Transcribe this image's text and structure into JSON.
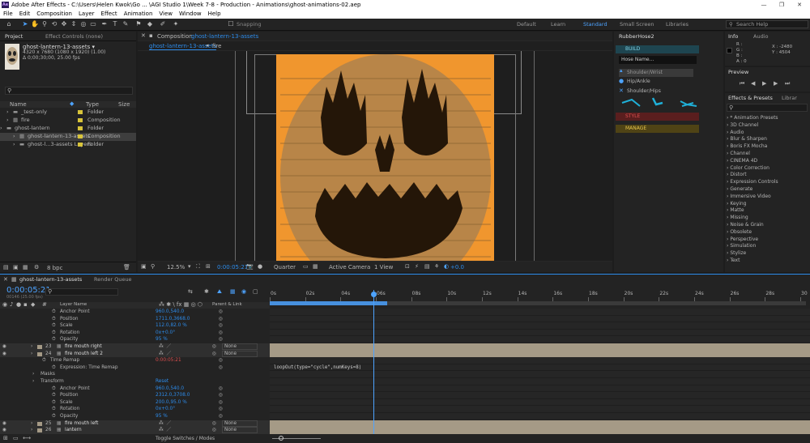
{
  "title": "Adobe After Effects - C:\\Users\\Helen Kwok\\Go ... \\AGI Studio 1\\Week 7-8 - Production - Animations\\ghost-animations-02.aep",
  "logo": "Ae",
  "menu": [
    "File",
    "Edit",
    "Composition",
    "Layer",
    "Effect",
    "Animation",
    "View",
    "Window",
    "Help"
  ],
  "toolbar": {
    "snapping": "Snapping"
  },
  "workspaces": [
    "Default",
    "Learn",
    "Standard",
    "Small Screen",
    "Libraries"
  ],
  "search_help": "Search Help",
  "project": {
    "tab_project": "Project",
    "tab_effect_controls": "Effect Controls (none)",
    "thumb_name": "ghost-lantern-13-assets ▾",
    "thumb_dims": "4320 x 7680  (1080 x 1920) (1.00)",
    "thumb_duration": "Δ 0;00;30;00, 25.00 fps",
    "columns": {
      "name": "Name",
      "type": "Type",
      "size": "Size"
    },
    "items": [
      {
        "name": "_test-only",
        "type": "Folder",
        "color": "#d8c43a",
        "indent": 1,
        "icon": "folder-icon"
      },
      {
        "name": "fire",
        "type": "Composition",
        "color": "#d8c43a",
        "indent": 1,
        "icon": "composition-icon"
      },
      {
        "name": "ghost-lantern",
        "type": "Folder",
        "color": "#d8c43a",
        "indent": 0,
        "icon": "folder-icon"
      },
      {
        "name": "ghost-lantern-13-assets",
        "type": "Composition",
        "color": "#d8c43a",
        "indent": 2,
        "icon": "composition-icon"
      },
      {
        "name": "ghost-l...3-assets Layers",
        "type": "Folder",
        "color": "#d8c43a",
        "indent": 2,
        "icon": "folder-icon"
      }
    ],
    "bpc": "8 bpc"
  },
  "composition": {
    "tab_label": "Composition",
    "tab_name": "ghost-lantern-13-assets",
    "breadcrumbs": [
      "ghost-lantern-13-assets",
      "fire"
    ],
    "zoom": "12.5%",
    "time": "0:00:05:21",
    "resolution": "Quarter",
    "camera": "Active Camera",
    "view": "1 View",
    "exposure": "+0.0",
    "bg_color": "#f0962e"
  },
  "rubberhose": {
    "title": "RubberHose2",
    "build": "BUILD",
    "hose_name": "Hose Name...",
    "options": [
      "Shoulder/Wrist",
      "Hip/Ankle",
      "Shoulder/Hips"
    ],
    "style": "STYLE",
    "manage": "MANAGE"
  },
  "info": {
    "tab_info": "Info",
    "tab_audio": "Audio",
    "r": "R :",
    "g": "G :",
    "b": "B :",
    "a": "A : 0",
    "x": "X : -2480",
    "y": "Y : 4504"
  },
  "preview": {
    "title": "Preview"
  },
  "effects": {
    "tab": "Effects & Presets",
    "tab2": "Librar",
    "items": [
      "* Animation Presets",
      "3D Channel",
      "Audio",
      "Blur & Sharpen",
      "Boris FX Mocha",
      "Channel",
      "CINEMA 4D",
      "Color Correction",
      "Distort",
      "Expression Controls",
      "Generate",
      "Immersive Video",
      "Keying",
      "Matte",
      "Missing",
      "Noise & Grain",
      "Obsolete",
      "Perspective",
      "Simulation",
      "Stylize",
      "Text"
    ]
  },
  "timeline": {
    "tab": "ghost-lantern-13-assets",
    "render_queue": "Render Queue",
    "time": "0:00:05:21",
    "frame_info": "00146 (25.00 fps)",
    "col_layer_name": "Layer Name",
    "col_parent": "Parent & Link",
    "ruler": [
      "0s",
      "02s",
      "04s",
      "06s",
      "08s",
      "10s",
      "12s",
      "14s",
      "16s",
      "18s",
      "20s",
      "22s",
      "24s",
      "26s",
      "28s",
      "30"
    ],
    "playhead_sec": 5.84,
    "rows": [
      {
        "kind": "prop",
        "indent": 5,
        "label": "Anchor Point",
        "value": "960.0,540.0"
      },
      {
        "kind": "prop",
        "indent": 5,
        "label": "Position",
        "value": "1711.0,3668.0"
      },
      {
        "kind": "prop",
        "indent": 5,
        "label": "Scale",
        "value": "112.0,82.0 %"
      },
      {
        "kind": "prop",
        "indent": 5,
        "label": "Rotation",
        "value": "0x+0.0°"
      },
      {
        "kind": "prop",
        "indent": 5,
        "label": "Opacity",
        "value": "95 %"
      },
      {
        "kind": "layer",
        "num": "23",
        "label": "fire mouth right",
        "parent": "None",
        "color": "#a59a86"
      },
      {
        "kind": "layer",
        "num": "24",
        "label": "fire mouth left 2",
        "parent": "None",
        "color": "#a59a86"
      },
      {
        "kind": "prop",
        "indent": 4,
        "label": "Time Remap",
        "value": "0:00:05:21",
        "red": true
      },
      {
        "kind": "prop",
        "indent": 5,
        "label": "Expression: Time Remap",
        "value": ""
      },
      {
        "kind": "group",
        "indent": 3,
        "label": "Masks",
        "value": ""
      },
      {
        "kind": "group",
        "indent": 3,
        "label": "Transform",
        "value": "Reset"
      },
      {
        "kind": "prop",
        "indent": 5,
        "label": "Anchor Point",
        "value": "960.0,540.0"
      },
      {
        "kind": "prop",
        "indent": 5,
        "label": "Position",
        "value": "2312.0,3708.0"
      },
      {
        "kind": "prop",
        "indent": 5,
        "label": "Scale",
        "value": "200.0,95.0 %"
      },
      {
        "kind": "prop",
        "indent": 5,
        "label": "Rotation",
        "value": "0x+0.0°"
      },
      {
        "kind": "prop",
        "indent": 5,
        "label": "Opacity",
        "value": "95 %"
      },
      {
        "kind": "layer",
        "num": "25",
        "label": "fire mouth left",
        "parent": "None",
        "color": "#a59a86"
      },
      {
        "kind": "layer",
        "num": "26",
        "label": "lantern",
        "parent": "None",
        "color": "#a59a86"
      }
    ],
    "expression": "loopOut(type=\"cycle\",numKeys=8)",
    "toggle": "Toggle Switches / Modes"
  }
}
